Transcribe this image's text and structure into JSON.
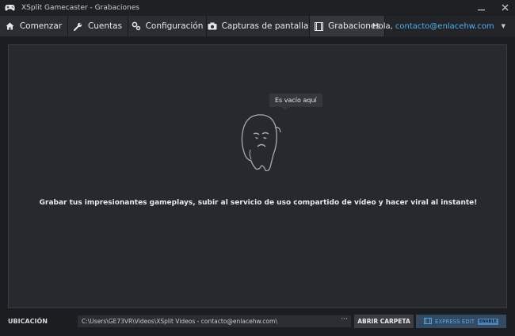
{
  "window": {
    "title": "XSplit Gamecaster - Grabaciones",
    "icons": {
      "app": "gamepad-icon",
      "minimize": "minimize-icon",
      "close": "close-icon"
    }
  },
  "tabs": [
    {
      "label": "Comenzar",
      "icon": "home-icon",
      "active": false
    },
    {
      "label": "Cuentas",
      "icon": "wrench-icon",
      "active": false
    },
    {
      "label": "Configuración",
      "icon": "gears-icon",
      "active": false
    },
    {
      "label": "Capturas de pantalla",
      "icon": "camera-icon",
      "active": false
    },
    {
      "label": "Grabaciones",
      "icon": "film-icon",
      "active": true
    }
  ],
  "user": {
    "greeting": "Hola,",
    "email": "contacto@enlacehw.com"
  },
  "main": {
    "tooltip": "Es vacío aquí",
    "illustration": "sad-ghost-icon",
    "message": "Grabar tus impresionantes gameplays, subir al servicio de uso compartido de vídeo y hacer viral al instante!"
  },
  "footer": {
    "location_label": "UBICACIÓN",
    "path": "C:\\Users\\GE73VR\\Videos\\XSplit Videos - contacto@enlacehw.com\\",
    "browse_label": "···",
    "open_folder_label": "ABRIR CARPETA",
    "express_edit_label": "EXPRESS EDIT",
    "express_badge": "ENABLE"
  },
  "colors": {
    "accent": "#4db1f0",
    "background": "#1b1d21",
    "panel": "#26292e"
  }
}
